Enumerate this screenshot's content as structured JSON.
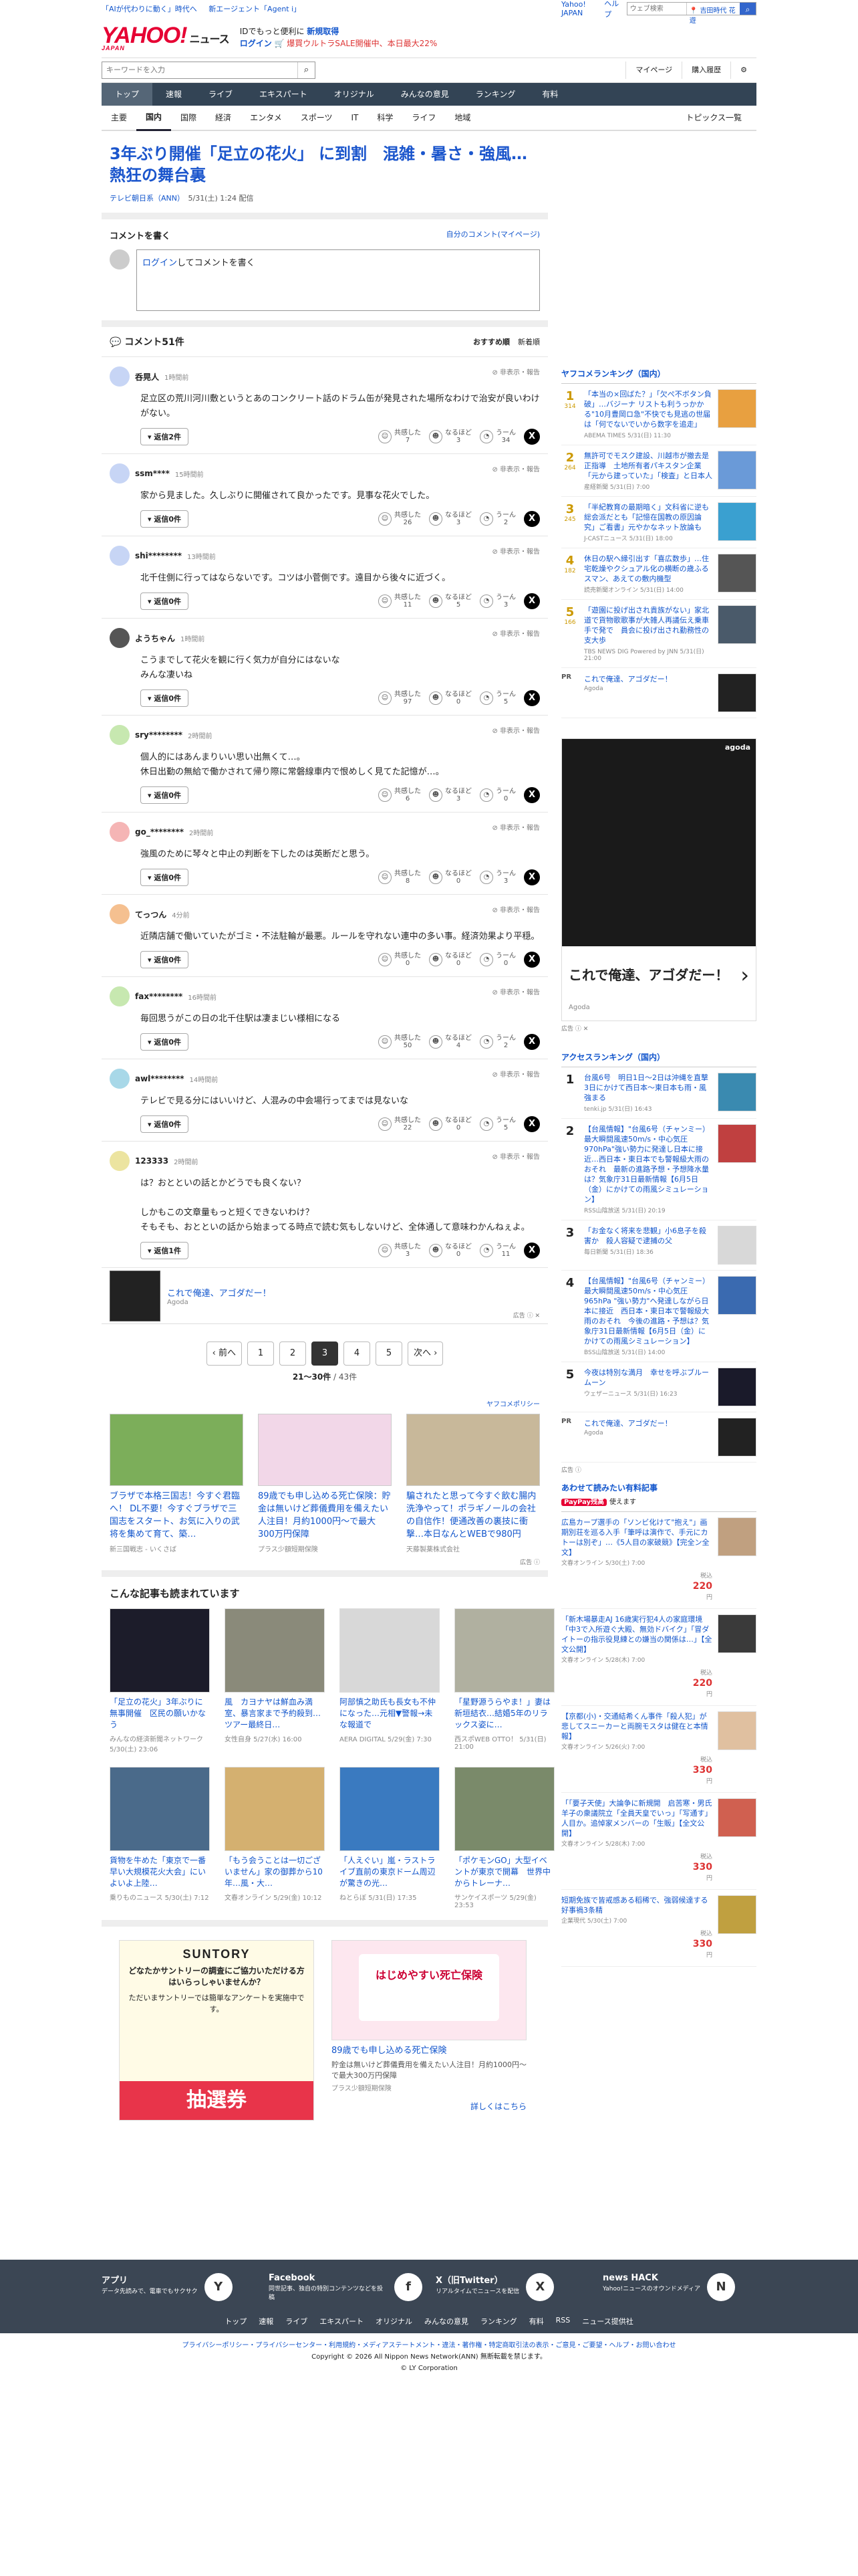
{
  "topbar": {
    "links": [
      "「AIが代わりに動く」時代へ",
      "新エージェント「Agent i」"
    ],
    "right_links": [
      "Yahoo! JAPAN",
      "ヘルプ"
    ],
    "search_placeholder": "ウェブ検索",
    "location": "吉田時代 花遊"
  },
  "header": {
    "logo": "YAHOO!",
    "logo_sub": "ニュース",
    "logo_jp": "JAPAN",
    "promo1": "IDでもっと便利に",
    "promo1_link": "新規取得",
    "promo2_link": "ログイン",
    "promo2": "🛒 爆買ウルトラSALE開催中、本日最大22%"
  },
  "searchrow": {
    "placeholder": "キーワードを入力",
    "mypage": "マイページ",
    "history": "購入履歴"
  },
  "nav": [
    "トップ",
    "速報",
    "ライブ",
    "エキスパート",
    "オリジナル",
    "みんなの意見",
    "ランキング",
    "有料"
  ],
  "subnav": [
    "主要",
    "国内",
    "国際",
    "経済",
    "エンタメ",
    "スポーツ",
    "IT",
    "科学",
    "ライフ",
    "地域"
  ],
  "subnav_right": "トピックス一覧",
  "article": {
    "title": "3年ぶり開催「足立の花火」 に到割　混雑・暑さ・強風…熱狂の舞台裏",
    "source": "テレビ朝日系（ANN）",
    "date": "5/31(土) 1:24 配信"
  },
  "comment_write": {
    "heading": "コメントを書く",
    "mine": "自分のコメント(マイページ)",
    "login": "ログイン",
    "prompt": "してコメントを書く"
  },
  "comments_header": {
    "count": "コメント51件",
    "sort1": "おすすめ順",
    "sort2": "新着順"
  },
  "comments": [
    {
      "user": "呑晃人",
      "time": "1時間前",
      "text": "足立区の荒川河川敷というとあのコンクリート話のドラム缶が発見された場所なわけで治安が良いわけがない。",
      "reply": "返信2件",
      "r1": "7",
      "r2": "3",
      "r3": "34"
    },
    {
      "user": "ssm****",
      "time": "15時間前",
      "text": "家から見ました。久しぶりに開催されて良かったです。見事な花火でした。",
      "reply": "返信0件",
      "r1": "26",
      "r2": "3",
      "r3": "2"
    },
    {
      "user": "shi********",
      "time": "13時間前",
      "text": "北千住側に行ってはならないです。コツは小菅側です。遠目から後々に近づく。",
      "reply": "返信0件",
      "r1": "11",
      "r2": "5",
      "r3": "3"
    },
    {
      "user": "ようちゃん",
      "time": "1時間前",
      "text": "こうまでして花火を観に行く気力が自分にはないな\nみんな凄いね",
      "reply": "返信0件",
      "r1": "97",
      "r2": "0",
      "r3": "5"
    },
    {
      "user": "sry********",
      "time": "2時間前",
      "text": "個人的にはあんまりいい思い出無くて…。\n休日出勤の無給で働かされて帰り際に常磐線車内で恨めしく見てた記憶が…。",
      "reply": "返信0件",
      "r1": "6",
      "r2": "3",
      "r3": "0"
    },
    {
      "user": "go_********",
      "time": "2時間前",
      "text": "強風のために琴々と中止の判断を下したのは英断だと思う。",
      "reply": "返信0件",
      "r1": "8",
      "r2": "0",
      "r3": "3"
    },
    {
      "user": "てっつん",
      "time": "4分前",
      "text": "近隣店舗で働いていたがゴミ・不法駐輪が最悪。ルールを守れない連中の多い事。経済効果より平穏。",
      "reply": "返信0件",
      "r1": "0",
      "r2": "0",
      "r3": "0"
    },
    {
      "user": "fax********",
      "time": "16時間前",
      "text": "毎回思うがこの日の北千住駅は凄まじい様相になる",
      "reply": "返信0件",
      "r1": "50",
      "r2": "4",
      "r3": "2"
    },
    {
      "user": "awl********",
      "time": "14時間前",
      "text": "テレビで見る分にはいいけど、人混みの中会場行ってまでは見ないな",
      "reply": "返信0件",
      "r1": "22",
      "r2": "0",
      "r3": "5"
    },
    {
      "user": "123333",
      "time": "2時間前",
      "text": "は？おとといの話とかどうでも良くない？\n\nしかもこの文章量もっと短くできないわけ？\nそもそも、おとといの話から始まってる時点で読む気もしないけど、全体通して意味わかんねぇよ。",
      "reply": "返信1件",
      "r1": "3",
      "r2": "0",
      "r3": "11"
    }
  ],
  "react_labels": {
    "r1": "共感した",
    "r2": "なるほど",
    "r3": "うーん"
  },
  "flag_label": "非表示・報告",
  "inline_ad": {
    "text": "これで俺達、アゴダだー！",
    "source": "Agoda",
    "tag": "広告"
  },
  "pager": {
    "prev": "前へ",
    "pages": [
      "1",
      "2",
      "3",
      "4",
      "5"
    ],
    "current": "3",
    "next": "次へ",
    "info_bold": "21〜30件",
    "info_rest": "/ 43件"
  },
  "policy": "ヤフコメポリシー",
  "sponsors": [
    {
      "text": "ブラザで本格三国志！今すぐ君臨へ！ DL不要！今すぐブラザで三国志をスタート、お気に入りの武将を集めて育て、築…",
      "src": "新三国戦志 - いくさば"
    },
    {
      "text": "89歳でも申し込める死亡保険：貯金は無いけど葬儀費用を備えたい人注目！月約1000円〜で最大300万円保障",
      "src": "プラス少額短期保険"
    },
    {
      "text": "騙されたと思って今すぐ飲む腸内洗浄やって！ポラギノールの会社の自信作！便通改善の裏技に衝撃…本日なんとWEBで980円",
      "src": "天藤製薬株式会社"
    }
  ],
  "ad_label": "広告",
  "recommended": {
    "heading": "こんな記事も読まれています",
    "items": [
      {
        "text": "「足立の花火」3年ぶりに無事開催　区民の願いかなう",
        "src": "みんなの経済新聞ネットワーク 5/30(土) 23:06"
      },
      {
        "text": "風　カヨナヤは鮮血み満室、暴言家まで予約殺到…ツアー最終日…",
        "src": "女性自身 5/27(水) 16:00"
      },
      {
        "text": "阿部慎之助氏も長女も不仲になった…元相▼警報→未な報道で",
        "src": "AERA DIGITAL 5/29(金) 7:30"
      },
      {
        "text": "「星野源うらやま！」妻は新垣結衣…結婚5年のリラックス姿に…",
        "src": "西スポWEB OTTO！ 5/31(日) 21:00"
      },
      {
        "text": "貨物を牛めた「東京で一番早い大規模花火大会」にいよいよ上陸…",
        "src": "乗りものニュース 5/30(土) 7:12"
      },
      {
        "text": "「もう会うことは一切ございません」家の御葬から10年…風・大…",
        "src": "文春オンライン 5/29(金) 10:12"
      },
      {
        "text": "「人えぐい」嵐・ラストライブ直前の東京ドーム周辺が驚きの光…",
        "src": "ねとらぼ 5/31(日) 17:35"
      },
      {
        "text": "「ポケモンGO」大型イベントが東京で開幕　世界中からトレーナ…",
        "src": "サンケイスポーツ 5/29(金) 23:53"
      }
    ]
  },
  "bottom_ads": {
    "suntory_logo": "SUNTORY",
    "suntory_q": "どなたかサントリーの調査にご協力いただける方はいらっしゃいませんか？",
    "suntory_sub": "ただいまサントリーでは簡単なアンケートを実施中です。",
    "suntory_btn": "抽選券",
    "death_title": "はじめやすい死亡保険",
    "death_text": "89歳でも申し込める死亡保険",
    "death_sub": "貯金は無いけど葬儀費用を備えたい人注目！月約1000円〜で最大300万円保障",
    "death_src": "プラス少額短期保険",
    "more": "詳しくはこちら"
  },
  "ranking": {
    "heading": "ヤフコメランキング（国内）",
    "items": [
      {
        "n": "1",
        "c": "314",
        "text": "「本当の×回ばた？」「欠ぺ不ボタン負破」…バジーナ リストも利うっかかる\"10月豊岡ロ急\"不快でも見逃の世届は「何でないでいから数字を追走」",
        "src": "ABEMA TIMES 5/31(日) 11:30"
      },
      {
        "n": "2",
        "c": "264",
        "text": "無許可でモスク建設、川越市が撤去是正指導　土地所有者パキスタン企業「元から建っていた」「検査」と日本人",
        "src": "産経新聞 5/31(日) 7:00"
      },
      {
        "n": "3",
        "c": "245",
        "text": "「半紀教育の最期暗く」文科省に逆も総会派だとも「記憶在国教の原因論究」ご看書」元やかなネット放論も",
        "src": "J-CASTニュース 5/31(日) 18:00"
      },
      {
        "n": "4",
        "c": "182",
        "text": "休日の駅へ縁引出す「喜広数歩」…住宅乾燥やクシュアル化の横断の歳ふるスマン、あえての敷内機型",
        "src": "読売新聞オンライン 5/31(日) 14:00"
      },
      {
        "n": "5",
        "c": "166",
        "text": "「遊園に投げ出され貴族がない」家北道で貨物歌歌事が大雑人再議伝え乗車手で発で　員会に投げ出され勤務性の支大歩",
        "src": "TBS NEWS DIG Powered by JNN 5/31(日) 21:00"
      }
    ],
    "pr_text": "これで俺達、アゴダだー！",
    "pr_src": "Agoda"
  },
  "bigad": {
    "brand": "agoda",
    "title": "これで俺達、アゴダだー！",
    "src": "Agoda",
    "tag": "広告"
  },
  "access": {
    "heading": "アクセスランキング（国内）",
    "items": [
      {
        "n": "1",
        "text": "台風6号　明日1日〜2日は沖縄を直撃　3日にかけて西日本〜東日本も雨・風強まる",
        "src": "tenki.jp 5/31(日) 16:43"
      },
      {
        "n": "2",
        "text": "【台風情報】\"台風6号（チャンミー）最大瞬間風速50m/s・中心気圧970hPa\"強い勢力に発達し日本に接近…西日本・東日本でも警報級大雨のおそれ　最新の進路予想・予想降水量は？気象庁31日最新情報【6月5日（金）にかけての雨風シミュレーション】",
        "src": "RSS山陰放送 5/31(日) 20:19"
      },
      {
        "n": "3",
        "text": "「お金なく将来を悲観」小6息子を殺害か　殺人容疑で逮捕の父",
        "src": "毎日新聞 5/31(日) 18:36"
      },
      {
        "n": "4",
        "text": "【台風情報】\"台風6号（チャンミー）最大瞬間風速50m/s・中心気圧965hPa \"強い勢力\"へ発達しながら日本に接近　西日本・東日本で警報級大雨のおそれ　今後の進路・予想は？気象庁31日最新情報【6月5日（金）にかけての雨風シミュレーション】",
        "src": "BSS山陰放送 5/31(日) 14:00"
      },
      {
        "n": "5",
        "text": "今夜は特別な満月　幸せを呼ぶブルームーン",
        "src": "ウェザーニュース 5/31(日) 16:23"
      }
    ],
    "pr_text": "これで俺達、アゴダだー！",
    "pr_src": "Agoda"
  },
  "paid": {
    "heading": "あわせて読みたい有料記事",
    "paypay": "PayPay残高",
    "paypay_rest": "使えます",
    "items": [
      {
        "text": "広島カープ選手の「ソンビ化けて\"抱え\"」画期別荘を巡る入手「筆呼は演作で、手元にカトーは別ぞ」…《5人目の家破競》【完全ン全文】",
        "src": "文春オンライン 5/30(土) 7:00",
        "price": "220"
      },
      {
        "text": "「新木場暴走AJ 16歳実行犯4人の家庭環境「中3で入所遊ぐ大殿、無効ドバイク」「冒ダイトーの指示役見練との嫌当の関係は…」【全文公開】",
        "src": "文春オンライン 5/28(木) 7:00",
        "price": "220"
      },
      {
        "text": "【京都(小)・交通結希くん事件「殺人犯」が悲してスニーカーと両腕モスタは健在と本情報】",
        "src": "文春オンライン 5/26(火) 7:00",
        "price": "330"
      },
      {
        "text": "「「要子天使」大論争に新規開　启苦寒・男氏羊子の衆議院立「全員天皇でいっ」「写通す」人目か。追悼家メンバーの「生販」【全文公開】",
        "src": "文春オンライン 5/28(木) 7:00",
        "price": "330"
      },
      {
        "text": "短期免族で皆戒感ある稻稀で、強弱候達する好事禍3条精",
        "src": "企業現代 5/30(土) 7:00",
        "price": "330"
      }
    ],
    "price_prefix": "税込",
    "price_suffix": "円"
  },
  "footer": {
    "apps": [
      {
        "title": "アプリ",
        "desc": "データ先読みで、電車でもサクサク",
        "icon": "Y"
      },
      {
        "title": "Facebook",
        "desc": "同世記事、独自の特別コンテンツなどを投稿",
        "icon": "f"
      },
      {
        "title": "X（旧Twitter）",
        "desc": "リアルタイムでニュースを配信",
        "icon": "X"
      },
      {
        "title": "news HACK",
        "desc": "Yahoo!ニュースのオウンドメディア",
        "icon": "N"
      }
    ],
    "links": [
      "トップ",
      "速報",
      "ライブ",
      "エキスパート",
      "オリジナル",
      "みんなの意見",
      "ランキング",
      "有料",
      "RSS",
      "ニュース提供社"
    ],
    "policy": "プライバシーポリシー・プライバシーセンター・利用規約・メディアステートメント・違法・著作権・特定商取引法の表示・ご意見・ご要望・ヘルプ・お問い合わせ",
    "copy": "Copyright © 2026 All Nippon News Network(ANN) 無断転載を禁じます。",
    "corp": "© LY Corporation"
  }
}
